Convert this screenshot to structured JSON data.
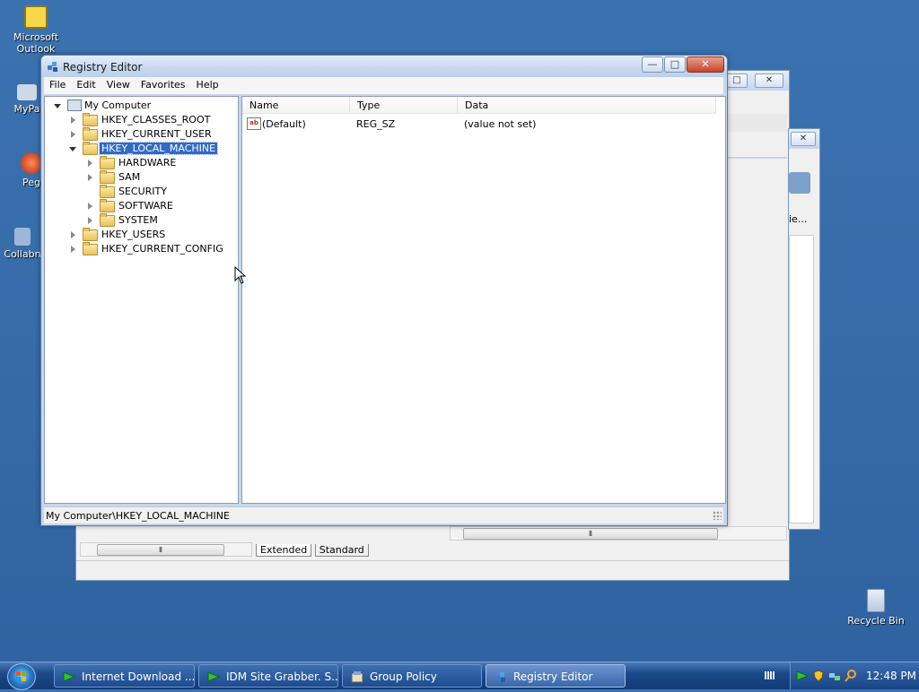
{
  "desktop": {
    "icons": [
      {
        "label": "Microsoft Outlook",
        "icon": "outlook-icon"
      },
      {
        "label": "MyPa",
        "icon": "mypc-icon"
      },
      {
        "label": "Peg",
        "icon": "peg-icon"
      },
      {
        "label": "Collabn",
        "icon": "collab-icon"
      },
      {
        "label": "Recycle Bin",
        "icon": "recycle-bin-icon"
      }
    ]
  },
  "background_window": {
    "tabs": [
      "Extended",
      "Standard"
    ],
    "partial_label": "ie..."
  },
  "registry_editor": {
    "title": "Registry Editor",
    "controls": {
      "minimize": "—",
      "maximize": "□",
      "close": "✕"
    },
    "menu": [
      "File",
      "Edit",
      "View",
      "Favorites",
      "Help"
    ],
    "tree": {
      "root": "My Computer",
      "nodes": [
        {
          "label": "HKEY_CLASSES_ROOT",
          "level": 1,
          "expanded": false
        },
        {
          "label": "HKEY_CURRENT_USER",
          "level": 1,
          "expanded": false
        },
        {
          "label": "HKEY_LOCAL_MACHINE",
          "level": 1,
          "expanded": true,
          "selected": true
        },
        {
          "label": "HARDWARE",
          "level": 2,
          "expanded": false
        },
        {
          "label": "SAM",
          "level": 2,
          "expanded": false
        },
        {
          "label": "SECURITY",
          "level": 2,
          "expanded": false
        },
        {
          "label": "SOFTWARE",
          "level": 2,
          "expanded": false
        },
        {
          "label": "SYSTEM",
          "level": 2,
          "expanded": false
        },
        {
          "label": "HKEY_USERS",
          "level": 1,
          "expanded": false
        },
        {
          "label": "HKEY_CURRENT_CONFIG",
          "level": 1,
          "expanded": false
        }
      ]
    },
    "list": {
      "columns": [
        "Name",
        "Type",
        "Data"
      ],
      "rows": [
        {
          "name": "(Default)",
          "type": "REG_SZ",
          "data": "(value not set)",
          "icon": "string-value-icon"
        }
      ]
    },
    "status": "My Computer\\HKEY_LOCAL_MACHINE"
  },
  "taskbar": {
    "tasks": [
      {
        "label": "Internet Download ...",
        "icon": "idm-icon",
        "active": false
      },
      {
        "label": "IDM Site Grabber. S...",
        "icon": "idm-icon",
        "active": false
      },
      {
        "label": "Group Policy",
        "icon": "group-policy-icon",
        "active": false
      },
      {
        "label": "Registry Editor",
        "icon": "regedit-icon",
        "active": true
      }
    ],
    "clock": "12:48 PM"
  }
}
